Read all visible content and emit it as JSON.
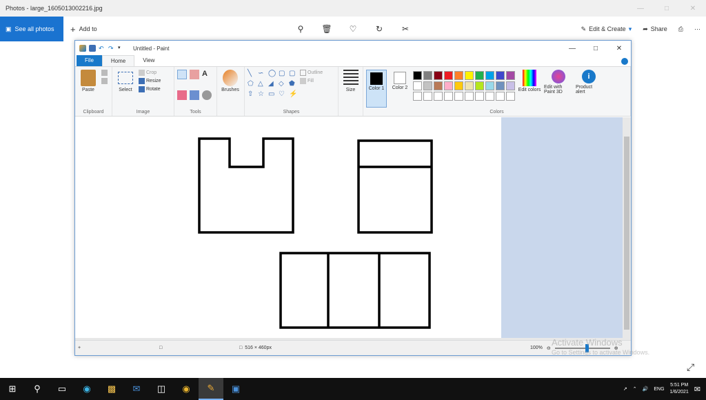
{
  "photos": {
    "title": "Photos - large_1605013002216.jpg",
    "see_all_label": "See all photos",
    "add_to_label": "Add to",
    "edit_create_label": "Edit & Create",
    "share_label": "Share"
  },
  "paint": {
    "title": "Untitled - Paint",
    "tabs": [
      "File",
      "Home",
      "View"
    ],
    "groups": {
      "clipboard": "Clipboard",
      "image": "Image",
      "tools": "Tools",
      "shapes": "Shapes",
      "colors": "Colors"
    },
    "buttons": {
      "paste": "Paste",
      "select": "Select",
      "crop": "Crop",
      "resize": "Resize",
      "rotate": "Rotate",
      "brushes": "Brushes",
      "outline": "Outline",
      "fill": "Fill",
      "size": "Size",
      "color1": "Color 1",
      "color2": "Color 2",
      "edit_colors": "Edit colors",
      "edit_paint3d": "Edit with Paint 3D",
      "product_alert": "Product alert"
    },
    "palette": [
      "#000000",
      "#7f7f7f",
      "#880015",
      "#ed1c24",
      "#ff7f27",
      "#fff200",
      "#22b14c",
      "#00a2e8",
      "#3f48cc",
      "#a349a4",
      "#ffffff",
      "#c3c3c3",
      "#b97a57",
      "#ffaec9",
      "#ffc90e",
      "#efe4b0",
      "#b5e61d",
      "#99d9ea",
      "#7092be",
      "#c8bfe7",
      "#ffffff",
      "#ffffff",
      "#ffffff",
      "#ffffff",
      "#ffffff",
      "#ffffff",
      "#ffffff",
      "#ffffff",
      "#ffffff",
      "#ffffff"
    ],
    "status_dimensions": "516 × 460px",
    "zoom": "100%"
  },
  "watermark": {
    "line1": "Activate Windows",
    "line2": "Go to Settings to activate Windows."
  },
  "taskbar": {
    "lang": "ENG",
    "time": "5:51 PM",
    "date": "1/6/2021"
  }
}
